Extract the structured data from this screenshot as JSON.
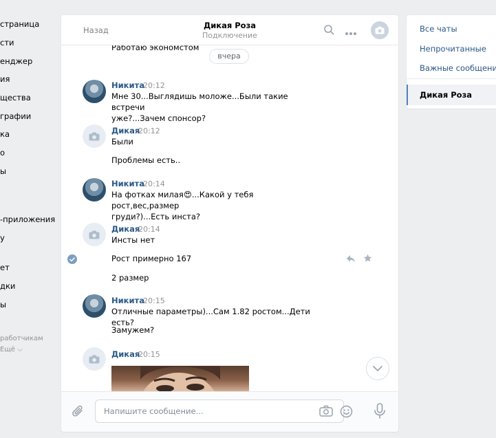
{
  "left_nav": {
    "items": [
      "страница",
      "сти",
      "енджер",
      "ия",
      "щества",
      "графии",
      "ка",
      "о",
      "ы",
      "-приложения",
      "у",
      "ет",
      "дки",
      "ы"
    ],
    "footer": [
      "работчикам",
      "Ещё ⌵"
    ]
  },
  "chat": {
    "back_label": "Назад",
    "peer_name": "Дикая Роза",
    "peer_status": "Подключение",
    "top_message": "Работаю экономстом",
    "date_label": "вчера",
    "messages": [
      {
        "author": "Никита",
        "time": "20:12",
        "lines": [
          "Мне 30...Выглядишь моложе...Были такие встречи",
          "уже?...Зачем спонсор?"
        ]
      },
      {
        "author": "Дикая",
        "time": "20:12",
        "lines": [
          "Были"
        ]
      },
      {
        "author": "",
        "time": "",
        "lines": [
          "Проблемы есть.."
        ]
      },
      {
        "author": "Никита",
        "time": "20:14",
        "lines": [
          "На фотках милая😍...Какой у тебя рост,вес,размер",
          "груди?)...Есть инста?"
        ]
      },
      {
        "author": "Дикая",
        "time": "20:14",
        "lines": [
          "Инсты нет"
        ]
      },
      {
        "author": "",
        "time": "",
        "lines": [
          "Рост примерно 167"
        ]
      },
      {
        "author": "",
        "time": "",
        "lines": [
          "2 размер"
        ]
      },
      {
        "author": "Никита",
        "time": "20:15",
        "lines": [
          "Отличные параметры)...Сам 1.82 ростом...Дети есть?"
        ]
      },
      {
        "author": "",
        "time": "",
        "lines": [
          "Замужем?"
        ]
      },
      {
        "author": "Дикая",
        "time": "20:15",
        "lines": []
      }
    ],
    "composer_placeholder": "Напишите сообщение..."
  },
  "right_panel": {
    "links": [
      "Все чаты",
      "Непрочитанные",
      "Важные сообщения"
    ],
    "active_chat": "Дикая Роза"
  },
  "icons": [
    "search-icon",
    "more-icon",
    "camera-icon",
    "reply-icon",
    "star-icon",
    "check-icon",
    "chevron-down-icon",
    "paperclip-icon",
    "smile-icon",
    "microphone-icon"
  ],
  "colors": {
    "accent": "#2a5885",
    "link": "#2a5885",
    "muted": "#939393",
    "active_border": "#5181b8"
  }
}
